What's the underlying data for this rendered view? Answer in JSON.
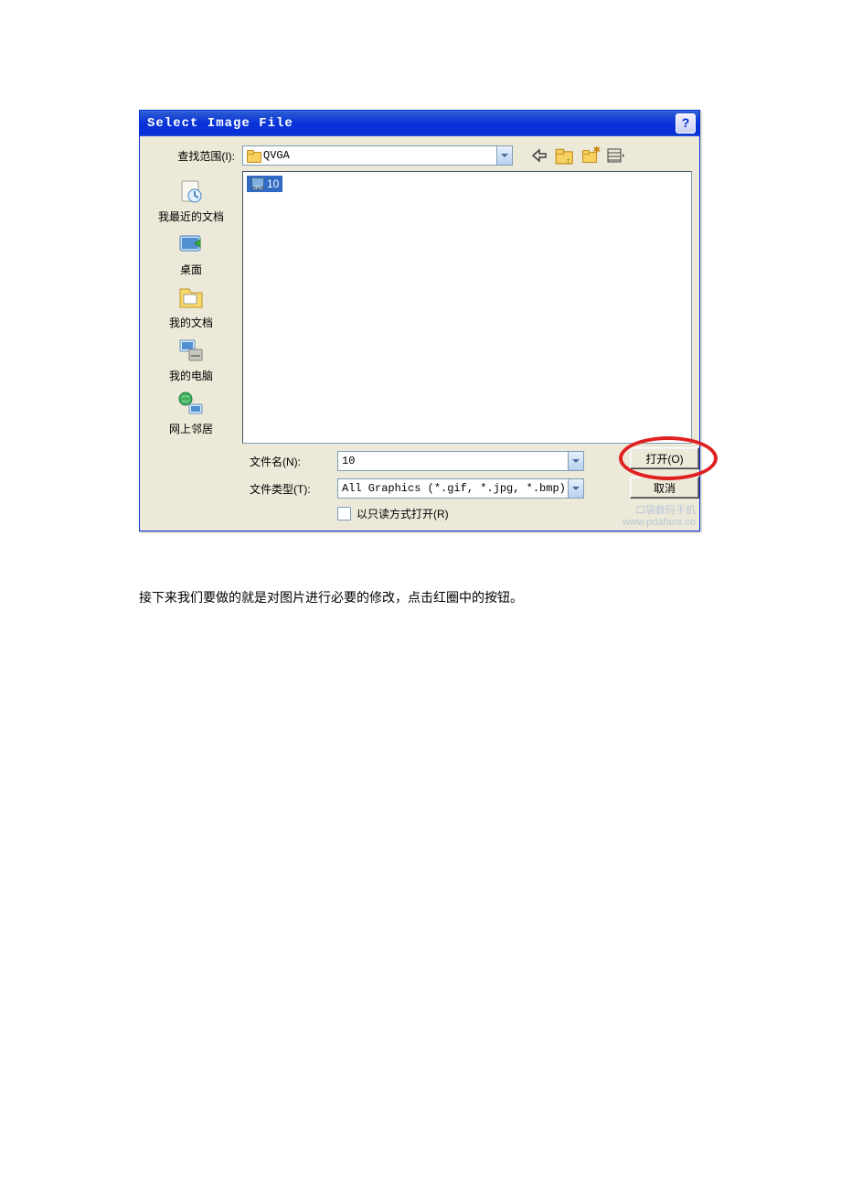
{
  "dialog": {
    "title": "Select Image File",
    "lookin_label": "查找范围(I):",
    "lookin_value": "QVGA",
    "places": [
      {
        "id": "recent",
        "label": "我最近的文档"
      },
      {
        "id": "desktop",
        "label": "桌面"
      },
      {
        "id": "mydocs",
        "label": "我的文档"
      },
      {
        "id": "mycomputer",
        "label": "我的电脑"
      },
      {
        "id": "network",
        "label": "网上邻居"
      }
    ],
    "file_list": [
      {
        "name": "10",
        "type": "jpg",
        "selected": true
      }
    ],
    "filename_label": "文件名(N):",
    "filename_value": "10",
    "filetype_label": "文件类型(T):",
    "filetype_value": "All Graphics (*.gif, *.jpg, *.bmp)",
    "readonly_label": "以只读方式打开(R)",
    "open_button": "打开(O)",
    "cancel_button": "取消",
    "watermark_line1": "口袋数码手机",
    "watermark_line2": "www.pdafans.co"
  },
  "caption": "接下来我们要做的就是对图片进行必要的修改，点击红圈中的按钮。"
}
